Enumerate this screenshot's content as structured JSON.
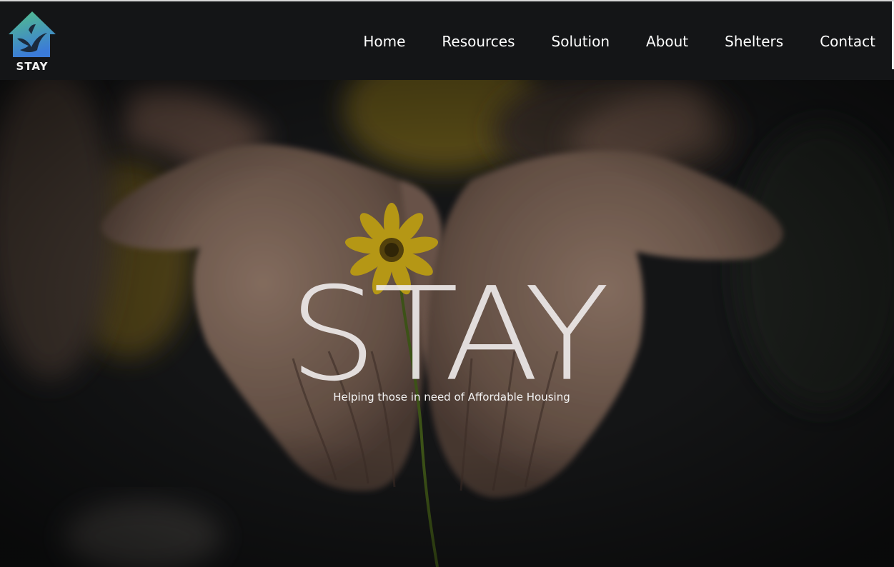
{
  "brand": {
    "logo_text": "STAY"
  },
  "nav": {
    "items": [
      {
        "label": "Home"
      },
      {
        "label": "Resources"
      },
      {
        "label": "Solution"
      },
      {
        "label": "About"
      },
      {
        "label": "Shelters"
      },
      {
        "label": "Contact"
      }
    ]
  },
  "hero": {
    "title": "STAY",
    "subtitle": "Helping those in need of Affordable Housing",
    "image_subject": "cupped hands holding a yellow flower"
  },
  "colors": {
    "navbar_bg": "#141517",
    "logo_gradient_top": "#4fb98a",
    "logo_gradient_bottom": "#3a7fd6",
    "flower": "#e8c21c",
    "title_text": "#f0ecec"
  }
}
